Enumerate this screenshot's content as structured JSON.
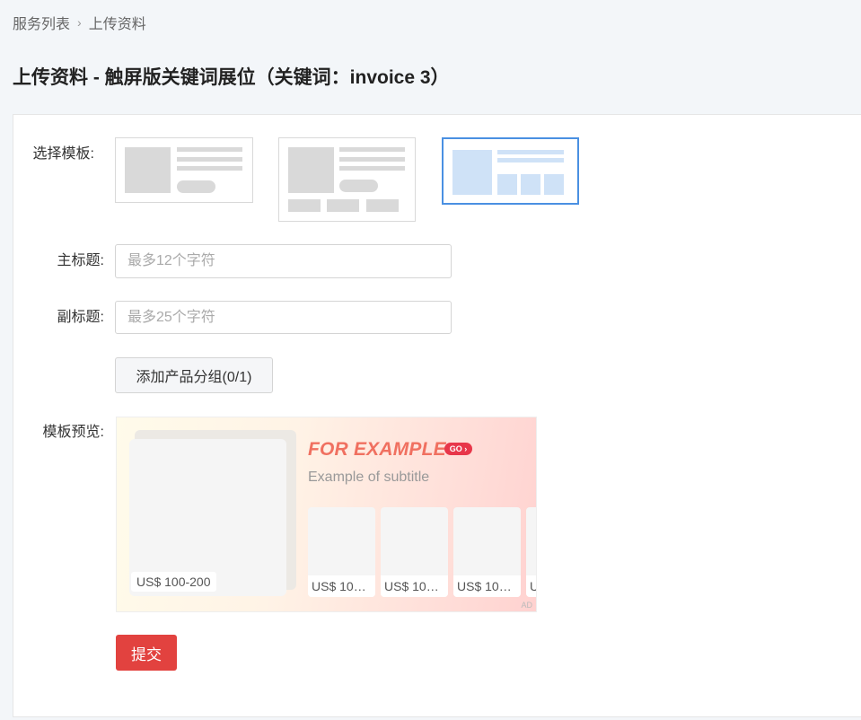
{
  "breadcrumb": {
    "items": [
      "服务列表",
      "上传资料"
    ],
    "separator": "›"
  },
  "page": {
    "title": "上传资料 - 触屏版关键词展位（关键词：invoice 3）"
  },
  "form": {
    "template_label": "选择模板:",
    "templates": [
      {
        "name": "template-1",
        "selected": false
      },
      {
        "name": "template-2",
        "selected": false
      },
      {
        "name": "template-3",
        "selected": true
      }
    ],
    "main_title_label": "主标题:",
    "main_title_placeholder": "最多12个字符",
    "main_title_value": "",
    "subtitle_label": "副标题:",
    "subtitle_placeholder": "最多25个字符",
    "subtitle_value": "",
    "add_group_button": "添加产品分组(0/1)",
    "preview_label": "模板预览:",
    "submit_button": "提交"
  },
  "preview": {
    "headline": "FOR EXAMPLE",
    "go_badge": "GO ›",
    "subtitle": "Example of subtitle",
    "main_price": "US$ 100-200",
    "product_prices": [
      "US$ 100…",
      "US$ 100…",
      "US$ 100…",
      "U"
    ],
    "ad_label": "AD"
  },
  "colors": {
    "accent": "#e2423f",
    "selected_border": "#4a90e2",
    "headline": "#f07060",
    "go_badge": "#e8364a"
  }
}
